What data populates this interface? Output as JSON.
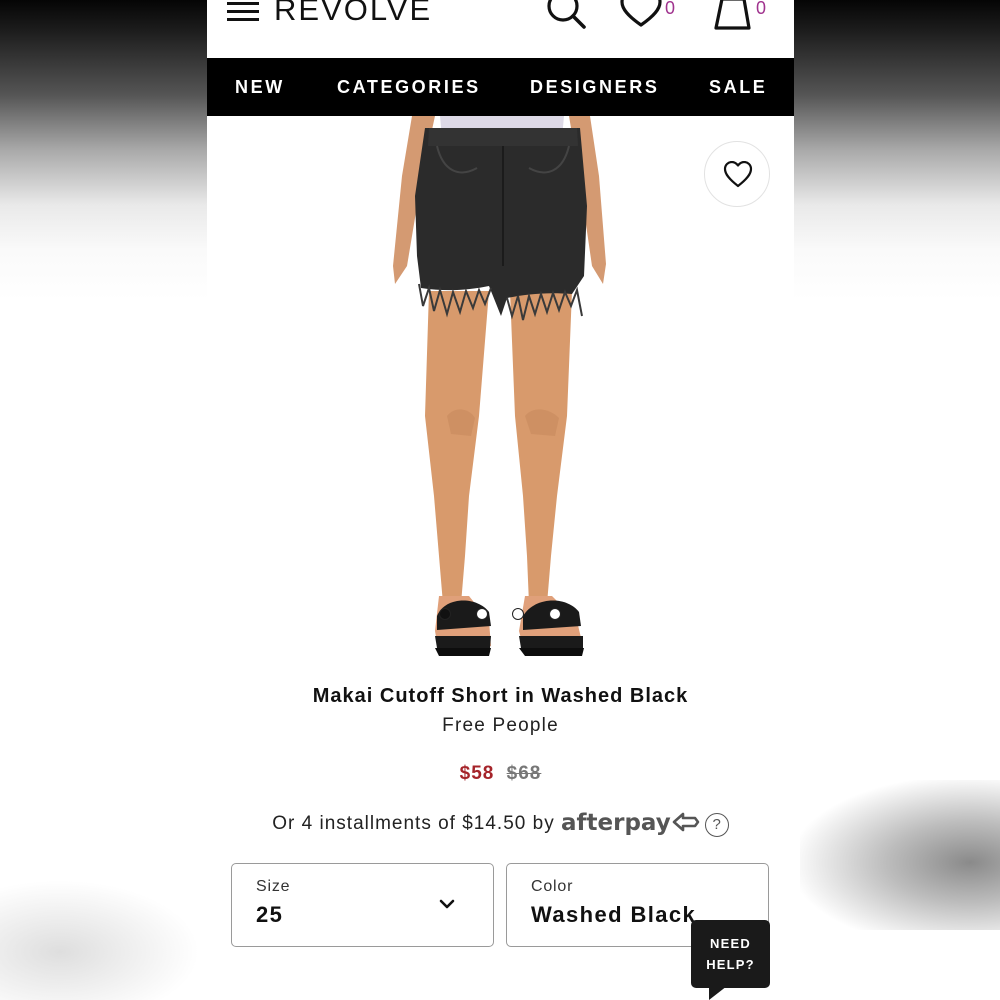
{
  "header": {
    "logo": "REVOLVE",
    "wishlist_count": "0",
    "bag_count": "0"
  },
  "nav": {
    "items": [
      {
        "label": "NEW"
      },
      {
        "label": "CATEGORIES"
      },
      {
        "label": "DESIGNERS"
      },
      {
        "label": "SALE"
      }
    ]
  },
  "product": {
    "name": "Makai Cutoff Short in Washed Black",
    "brand": "Free People",
    "sale_price": "$58",
    "original_price": "$68",
    "installments_text": "Or 4 installments of $14.50 by",
    "afterpay_label": "afterpay",
    "help_symbol": "?",
    "carousel": {
      "total_images": 4,
      "active_index": 0
    }
  },
  "selectors": {
    "size": {
      "label": "Size",
      "value": "25"
    },
    "color": {
      "label": "Color",
      "value": "Washed Black"
    }
  },
  "chat": {
    "line1": "NEED",
    "line2": "HELP?"
  },
  "colors": {
    "accent_sale": "#a5242a",
    "badge_count": "#a0338e",
    "nav_background": "#000000"
  },
  "icons": [
    "hamburger-menu-icon",
    "search-icon",
    "heart-icon",
    "shopping-bag-icon",
    "chevron-down-icon",
    "afterpay-logo-icon",
    "help-circle-icon"
  ]
}
